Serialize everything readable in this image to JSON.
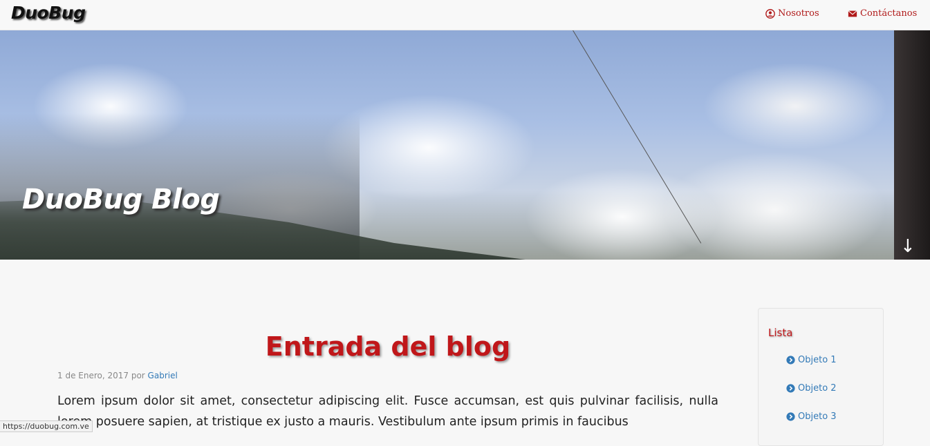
{
  "navbar": {
    "brand": "DuoBug",
    "links": [
      {
        "label": "Nosotros",
        "icon": "user-circle-icon"
      },
      {
        "label": "Contáctanos",
        "icon": "envelope-icon"
      }
    ]
  },
  "hero": {
    "title": "DuoBug Blog",
    "arrow": "↓"
  },
  "post": {
    "title": "Entrada del blog",
    "meta_date": "1 de Enero, 2017 por ",
    "meta_author": "Gabriel",
    "body": "Lorem ipsum dolor sit amet, consectetur adipiscing elit. Fusce accumsan, est quis pulvinar facilisis, nulla lorem posuere sapien, at tristique ex justo a mauris. Vestibulum ante ipsum primis in faucibus"
  },
  "sidebar": {
    "title": "Lista",
    "items": [
      {
        "label": "Objeto 1"
      },
      {
        "label": "Objeto 2"
      },
      {
        "label": "Objeto 3"
      }
    ]
  },
  "statusbar": {
    "url": "https://duobug.com.ve"
  },
  "colors": {
    "accent": "#c0171a",
    "link": "#337ab7"
  }
}
